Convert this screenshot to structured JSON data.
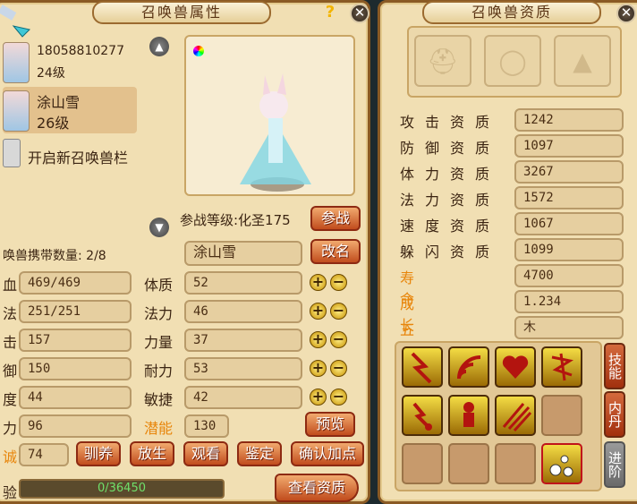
{
  "left_panel": {
    "title": "召唤兽属性",
    "help_label": "?",
    "close_label": "✕",
    "pets": [
      {
        "name": "18058810277",
        "level": "24级"
      },
      {
        "name": "涂山雪",
        "level": "26级"
      }
    ],
    "unlock_slot_label": "开启新召唤兽栏",
    "battle_level": "参战等级:化圣175",
    "battle_button": "参战",
    "carry_count": "唤兽携带数量: 2/8",
    "pet_name_value": "涂山雪",
    "rename_button": "改名",
    "left_stats": [
      {
        "label": "血",
        "value": "469/469"
      },
      {
        "label": "法",
        "value": "251/251"
      },
      {
        "label": "击",
        "value": "157"
      },
      {
        "label": "御",
        "value": "150"
      },
      {
        "label": "度",
        "value": "44"
      },
      {
        "label": "力",
        "value": "96"
      },
      {
        "label": "诚",
        "value": "74"
      }
    ],
    "attributes": [
      {
        "label": "体质",
        "value": "52"
      },
      {
        "label": "法力",
        "value": "46"
      },
      {
        "label": "力量",
        "value": "37"
      },
      {
        "label": "耐力",
        "value": "53"
      },
      {
        "label": "敏捷",
        "value": "42"
      }
    ],
    "potential_label": "潜能",
    "potential_value": "130",
    "preview_button": "预览",
    "plus_symbol": "+",
    "minus_symbol": "−",
    "actions": [
      "驯养",
      "放生",
      "观看",
      "鉴定",
      "确认加点"
    ],
    "exp_label": "验",
    "exp_value": "0/36450",
    "exp_progress": 0,
    "view_aptitude_button": "查看资质"
  },
  "right_panel": {
    "title": "召唤兽资质",
    "close_label": "✕",
    "aptitudes": [
      {
        "label": "攻击资质",
        "value": "1242"
      },
      {
        "label": "防御资质",
        "value": "1097"
      },
      {
        "label": "体力资质",
        "value": "3267"
      },
      {
        "label": "法力资质",
        "value": "1572"
      },
      {
        "label": "速度资质",
        "value": "1067"
      },
      {
        "label": "躲闪资质",
        "value": "1099"
      }
    ],
    "lifespan_label": "寿命",
    "lifespan_value": "4700",
    "growth_label": "成长",
    "growth_value": "1.234",
    "element_label": "五行",
    "element_value": "木",
    "tabs": [
      "技能",
      "内丹",
      "进阶"
    ],
    "skill_icons": [
      "lightning-skill-icon",
      "sound-wave-skill-icon",
      "heart-skill-icon",
      "rune-skill-icon",
      "thunder-strike-skill-icon",
      "figure-skill-icon",
      "claw-slash-skill-icon"
    ],
    "colors": {
      "accent": "#c14c1d",
      "skill_gold": "#f3dc44",
      "orange_text": "#e8860c"
    }
  }
}
